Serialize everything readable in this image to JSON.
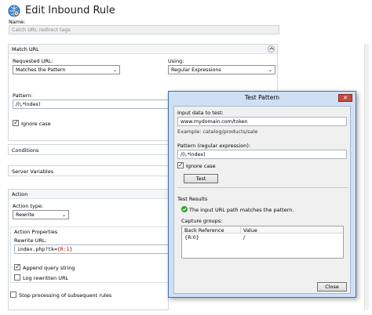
{
  "header": {
    "title": "Edit Inbound Rule",
    "name_label": "Name:",
    "name_value": "Catch URL redirect tags"
  },
  "match_url": {
    "group_label": "Match URL",
    "requested_url_label": "Requested URL:",
    "requested_url_value": "Matches the Pattern",
    "using_label": "Using:",
    "using_value": "Regular Expressions",
    "pattern_label": "Pattern:",
    "pattern_value": "/(\\.*index)",
    "ignore_case_label": "Ignore case"
  },
  "sections": {
    "conditions": "Conditions",
    "server_variables": "Server Variables",
    "action": "Action"
  },
  "action": {
    "type_label": "Action type:",
    "type_value": "Rewrite",
    "properties_label": "Action Properties",
    "rewrite_url_label": "Rewrite URL:",
    "rewrite_url_prefix": "index.php?tk=",
    "rewrite_url_var": "{R:1}",
    "append_query_label": "Append query string",
    "log_rewritten_label": "Log rewritten URL",
    "stop_processing_label": "Stop processing of subsequent rules"
  },
  "dialog": {
    "title": "Test Pattern",
    "input_label": "Input data to test:",
    "input_value": "www.mydomain.com/token",
    "example_text": "Example: catalog/products/sale",
    "pattern_label": "Pattern (regular expression):",
    "pattern_value": "/(\\.*index)",
    "ignore_case_label": "Ignore case",
    "test_button": "Test",
    "results_label": "Test Results",
    "result_message": "The input URL path matches the pattern.",
    "capture_label": "Capture groups:",
    "columns": [
      "Back Reference",
      "Value"
    ],
    "rows": [
      {
        "ref": "{R:0}",
        "value": "/"
      }
    ],
    "close_button": "Close"
  },
  "colors": {
    "accent": "#3d70b0",
    "success": "#2e9e2e",
    "title_text": "#1e1e1e"
  }
}
